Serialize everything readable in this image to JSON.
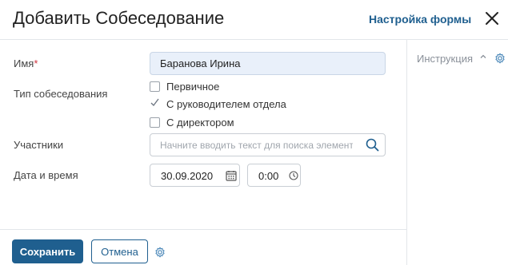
{
  "header": {
    "title": "Добавить Собеседование",
    "settings_link": "Настройка формы",
    "close_icon": "close-icon"
  },
  "form": {
    "name": {
      "label": "Имя",
      "required_mark": "*",
      "value": "Баранова Ирина"
    },
    "interview_type": {
      "label": "Тип собеседования",
      "options": [
        {
          "label": "Первичное",
          "checked": false
        },
        {
          "label": "С руководителем отдела",
          "checked": true
        },
        {
          "label": "С директором",
          "checked": false
        }
      ]
    },
    "participants": {
      "label": "Участники",
      "placeholder": "Начните вводить текст для поиска элемента",
      "icon": "search-icon"
    },
    "datetime": {
      "label": "Дата и время",
      "date": "30.09.2020",
      "time": "0:00",
      "date_icon": "calendar-icon",
      "time_icon": "clock-icon"
    }
  },
  "side_panel": {
    "instruction": "Инструкция",
    "chevron_icon": "chevron-up-icon",
    "gear_icon": "gear-icon"
  },
  "footer": {
    "save_label": "Сохранить",
    "cancel_label": "Отмена",
    "gear_icon": "gear-icon"
  },
  "colors": {
    "accent": "#1f5f8f",
    "required": "#d0343f",
    "input_filled_bg": "#e9f0fa",
    "border": "#e3e6ea"
  }
}
